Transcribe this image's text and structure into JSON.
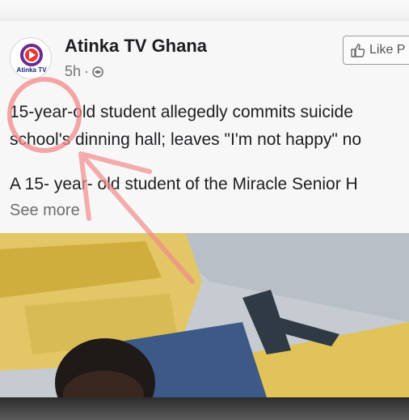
{
  "post": {
    "page_name": "Atinka TV Ghana",
    "avatar_label": "Atinka TV",
    "time": "5h",
    "dot": "·",
    "like_button_label": "Like P",
    "headline_line1": "15-year-old student allegedly commits suicide",
    "headline_line2": "school's dinning hall; leaves \"I'm not happy\" no",
    "body": "A 15- year- old  student of the Miracle Senior H",
    "see_more": "See more"
  },
  "colors": {
    "brand_purple": "#6b2a8c",
    "annotation": "#f28a8a"
  },
  "icons": {
    "globe": "globe-icon",
    "thumbs_up": "thumbs-up-icon",
    "logo": "atinka-play-logo"
  }
}
